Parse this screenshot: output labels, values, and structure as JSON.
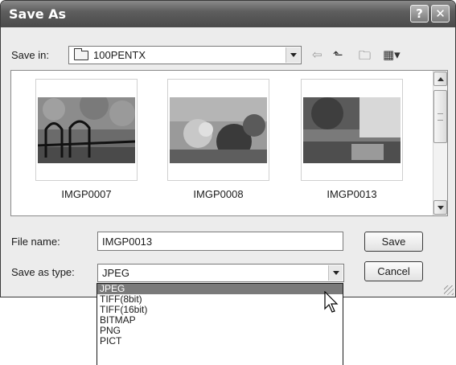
{
  "window": {
    "title": "Save As"
  },
  "titlebar": {
    "help_glyph": "?",
    "close_glyph": "✕"
  },
  "toolbar": {
    "save_in_label": "Save in:",
    "save_in_value": "100PENTX",
    "back_glyph": "⇦",
    "up_glyph": "⬑",
    "new_folder_glyph": "🗀",
    "views_glyph": "▦▾"
  },
  "files": [
    {
      "name": "IMGP0007"
    },
    {
      "name": "IMGP0008"
    },
    {
      "name": "IMGP0013"
    }
  ],
  "form": {
    "file_name_label": "File name:",
    "file_name_value": "IMGP0013",
    "save_as_type_label": "Save as type:",
    "save_as_type_value": "JPEG",
    "save_button": "Save",
    "cancel_button": "Cancel"
  },
  "type_options": [
    "JPEG",
    "TIFF(8bit)",
    "TIFF(16bit)",
    "BITMAP",
    "PNG",
    "PICT"
  ],
  "colors": {
    "selected_option_bg": "#7a7a7a",
    "titlebar": "#5e5e5e"
  }
}
